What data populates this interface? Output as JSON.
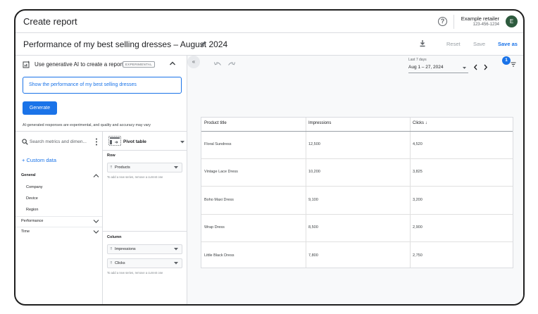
{
  "app": {
    "title": "Create report",
    "account_name": "Example retailer",
    "account_id": "123-456-1234",
    "avatar_letter": "E"
  },
  "toolbar": {
    "report_title": "Performance of my best selling dresses – August 2024",
    "reset_label": "Reset",
    "save_label": "Save",
    "save_as_label": "Save as"
  },
  "ai_panel": {
    "label": "Use generative AI to create a report",
    "badge": "EXPERIMENTAL",
    "prompt_value": "Show the performance of my best selling dresses",
    "generate_label": "Generate",
    "disclaimer": "AI-generated responses are experimental, and quality and accuracy may vary"
  },
  "fields": {
    "search_placeholder": "Search metrics and dimen...",
    "custom_data_label": "+ Custom data",
    "groups": {
      "general": "General",
      "performance": "Performance",
      "time": "Time"
    },
    "general_items": [
      "Company",
      "Device",
      "Region"
    ]
  },
  "config": {
    "visualization": "Pivot table",
    "row_label": "Row",
    "row_chip": "Products",
    "row_hint": "To add a new series, remove a current one",
    "column_label": "Column",
    "column_chips": [
      "Impressions",
      "Clicks"
    ],
    "column_hint": "To add a new series, remove a current one"
  },
  "canvas": {
    "collapse_glyph": "«",
    "date_label": "Last 7 days",
    "date_range": "Aug 1 – 27, 2024",
    "notification_count": "1"
  },
  "table": {
    "headers": [
      "Product title",
      "Impressions",
      "Clicks ↓"
    ],
    "rows": [
      [
        "Floral Sundress",
        "12,500",
        "4,520"
      ],
      [
        "Vintage Lace Dress",
        "10,200",
        "3,825"
      ],
      [
        "Boho Maxi Dress",
        "9,100",
        "3,200"
      ],
      [
        "Wrap Dress",
        "8,500",
        "2,900"
      ],
      [
        "Little Black Dress",
        "7,800",
        "2,750"
      ]
    ]
  },
  "colors": {
    "accent": "#1a73e8",
    "avatar_bg": "#2d5a3d",
    "border": "#dadce0"
  }
}
